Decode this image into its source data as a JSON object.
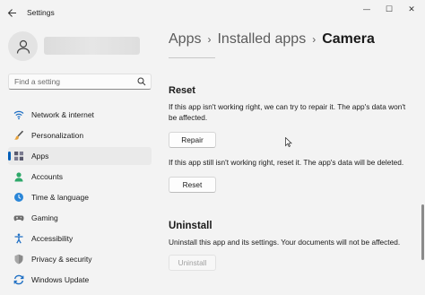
{
  "window": {
    "title": "Settings",
    "minimize_glyph": "—",
    "maximize_glyph": "☐",
    "close_glyph": "✕"
  },
  "sidebar": {
    "search": {
      "placeholder": "Find a setting",
      "value": ""
    },
    "items": [
      {
        "label": "Network & internet",
        "icon": "wifi-icon",
        "selected": false
      },
      {
        "label": "Personalization",
        "icon": "paintbrush-icon",
        "selected": false
      },
      {
        "label": "Apps",
        "icon": "apps-icon",
        "selected": true
      },
      {
        "label": "Accounts",
        "icon": "person-icon",
        "selected": false
      },
      {
        "label": "Time & language",
        "icon": "globe-clock-icon",
        "selected": false
      },
      {
        "label": "Gaming",
        "icon": "gamepad-icon",
        "selected": false
      },
      {
        "label": "Accessibility",
        "icon": "accessibility-icon",
        "selected": false
      },
      {
        "label": "Privacy & security",
        "icon": "shield-icon",
        "selected": false
      },
      {
        "label": "Windows Update",
        "icon": "update-icon",
        "selected": false
      }
    ]
  },
  "breadcrumb": {
    "level1": "Apps",
    "level2": "Installed apps",
    "current": "Camera",
    "separator": "›"
  },
  "reset_section": {
    "title": "Reset",
    "repair_text": "If this app isn't working right, we can try to repair it. The app's data won't be affected.",
    "repair_button": "Repair",
    "reset_text": "If this app still isn't working right, reset it. The app's data will be deleted.",
    "reset_button": "Reset"
  },
  "uninstall_section": {
    "title": "Uninstall",
    "text": "Uninstall this app and its settings. Your documents will not be affected.",
    "button": "Uninstall",
    "button_disabled": true
  },
  "colors": {
    "accent": "#005fb8",
    "background": "#f3f3f3"
  }
}
